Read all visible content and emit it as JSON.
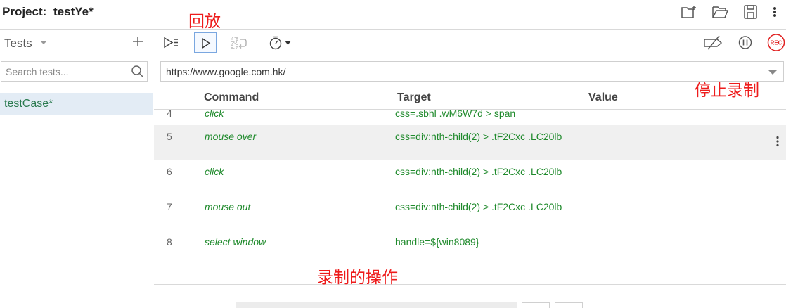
{
  "header": {
    "project_label": "Project:",
    "project_name": "testYe*",
    "icons": [
      "new-folder-plus-icon",
      "open-folder-icon",
      "save-disk-icon",
      "more-vertical-icon"
    ]
  },
  "sidebar": {
    "title": "Tests",
    "add_icon": "plus-icon",
    "search_placeholder": "Search tests...",
    "tests": [
      {
        "label": "testCase*",
        "selected": true
      }
    ]
  },
  "toolbar": {
    "buttons": [
      {
        "icon": "run-all-tests-icon",
        "active": false
      },
      {
        "icon": "run-current-test-icon",
        "active": true
      },
      {
        "icon": "step-over-icon",
        "active": false
      },
      {
        "icon": "speed-timer-icon",
        "active": false
      },
      {
        "icon": "disable-breakpoints-icon",
        "active": false
      },
      {
        "icon": "pause-on-exceptions-icon",
        "active": false
      },
      {
        "icon": "record-button",
        "active": false
      }
    ],
    "record_label": "REC"
  },
  "url": {
    "value": "https://www.google.com.hk/"
  },
  "table": {
    "headers": {
      "command": "Command",
      "target": "Target",
      "value": "Value"
    },
    "rows": [
      {
        "num": "4",
        "command": "click",
        "target": "css=.sbhl .wM6W7d > span",
        "value": ""
      },
      {
        "num": "5",
        "command": "mouse over",
        "target": "css=div:nth-child(2) > .tF2Cxc .LC20lb",
        "value": ""
      },
      {
        "num": "6",
        "command": "click",
        "target": "css=div:nth-child(2) > .tF2Cxc .LC20lb",
        "value": ""
      },
      {
        "num": "7",
        "command": "mouse out",
        "target": "css=div:nth-child(2) > .tF2Cxc .LC20lb",
        "value": ""
      },
      {
        "num": "8",
        "command": "select window",
        "target": "handle=${win8089}",
        "value": ""
      }
    ]
  },
  "annotations": {
    "playback": "回放",
    "stop_recording": "停止录制",
    "recorded_actions": "录制的操作"
  },
  "colors": {
    "command_green": "#1f8a2c",
    "annotation_red": "#ee1c1c",
    "selected_test_bg": "#e3ecf5",
    "rec_red": "#e02020"
  }
}
